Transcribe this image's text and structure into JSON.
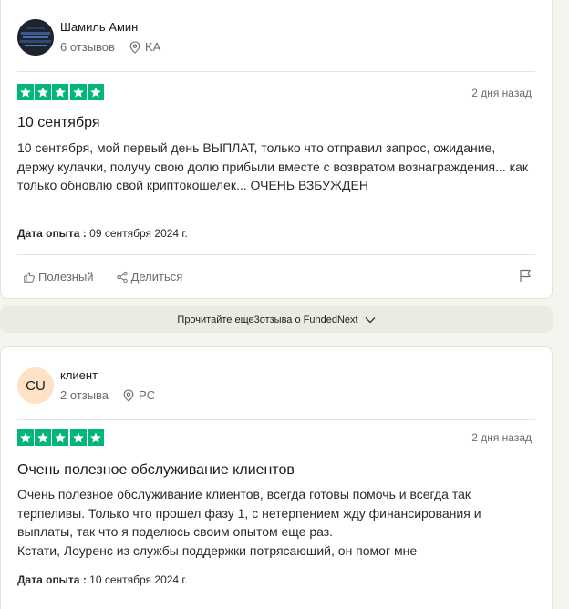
{
  "reviews": [
    {
      "author": "Шамиль Амин",
      "review_count": "6 отзывов",
      "country": "KA",
      "date_ago": "2 дня назад",
      "title": "10 сентября",
      "body": "10 сентября, мой первый день ВЫПЛАТ, только что отправил запрос, ожидание, держу кулачки, получу свою долю прибыли вместе с возвратом вознаграждения... как только обновлю свой криптокошелек... ОЧЕНЬ ВЗБУЖДЕН",
      "experience_label": "Дата опыта :",
      "experience_date": "09 сентября 2024 г.",
      "rating": 5
    },
    {
      "author": "клиент",
      "avatar_initials": "CU",
      "review_count": "2 отзыва",
      "country": "PC",
      "date_ago": "2 дня назад",
      "title": "Очень полезное обслуживание клиентов",
      "body": "Очень полезное обслуживание клиентов, всегда готовы помочь и всегда так терпеливы. Только что прошел фазу 1, с нетерпением жду финансирования и выплаты, так что я поделюсь своим опытом еще раз.\nКстати, Лоуренс из службы поддержки потрясающий, он помог мне",
      "experience_label": "Дата опыта :",
      "experience_date": "10 сентября 2024 г.",
      "rating": 5
    }
  ],
  "actions": {
    "useful": "Полезный",
    "share": "Делиться"
  },
  "more_reviews": "Прочитайте еще3отзыва о FundedNext",
  "colors": {
    "star_green": "#00b67a",
    "avatar_peach": "#fde2c6",
    "page_bg": "#f5f5f0"
  },
  "icons": [
    "location-pin-icon",
    "thumbs-up-icon",
    "share-icon",
    "flag-icon",
    "chevron-down-icon",
    "star-icon"
  ]
}
